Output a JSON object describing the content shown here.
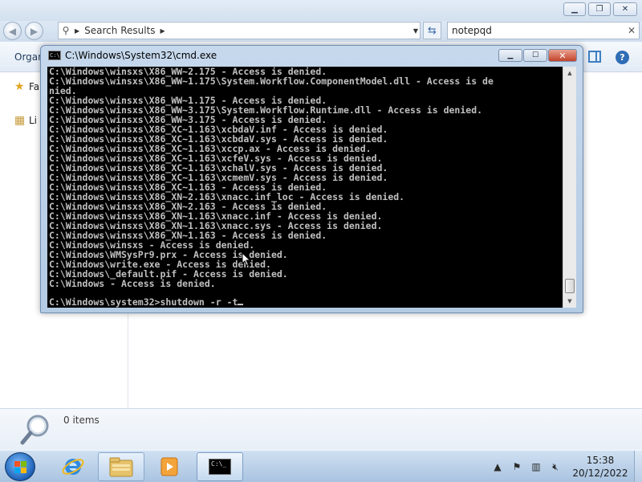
{
  "explorer": {
    "address": {
      "path_label": "Search Results"
    },
    "search": {
      "value": "notepqd"
    },
    "toolbar": {
      "organize_label": "Organ"
    },
    "nav_pane": {
      "favorites_label": "Fa",
      "libraries_label": "Li"
    },
    "details": {
      "items_count": "0 items"
    }
  },
  "cmd": {
    "title": "C:\\Windows\\System32\\cmd.exe",
    "icon_text": "C:\\",
    "lines": [
      "C:\\Windows\\winsxs\\X86_WW~2.175 - Access is denied.",
      "C:\\Windows\\winsxs\\X86_WW~1.175\\System.Workflow.ComponentModel.dll - Access is de",
      "nied.",
      "C:\\Windows\\winsxs\\X86_WW~1.175 - Access is denied.",
      "C:\\Windows\\winsxs\\X86_WW~3.175\\System.Workflow.Runtime.dll - Access is denied.",
      "C:\\Windows\\winsxs\\X86_WW~3.175 - Access is denied.",
      "C:\\Windows\\winsxs\\X86_XC~1.163\\xcbdaV.inf - Access is denied.",
      "C:\\Windows\\winsxs\\X86_XC~1.163\\xcbdaV.sys - Access is denied.",
      "C:\\Windows\\winsxs\\X86_XC~1.163\\xccp.ax - Access is denied.",
      "C:\\Windows\\winsxs\\X86_XC~1.163\\xcfeV.sys - Access is denied.",
      "C:\\Windows\\winsxs\\X86_XC~1.163\\xchalV.sys - Access is denied.",
      "C:\\Windows\\winsxs\\X86_XC~1.163\\xcmemV.sys - Access is denied.",
      "C:\\Windows\\winsxs\\X86_XC~1.163 - Access is denied.",
      "C:\\Windows\\winsxs\\X86_XN~2.163\\xnacc.inf_loc - Access is denied.",
      "C:\\Windows\\winsxs\\X86_XN~2.163 - Access is denied.",
      "C:\\Windows\\winsxs\\X86_XN~1.163\\xnacc.inf - Access is denied.",
      "C:\\Windows\\winsxs\\X86_XN~1.163\\xnacc.sys - Access is denied.",
      "C:\\Windows\\winsxs\\X86_XN~1.163 - Access is denied.",
      "C:\\Windows\\winsxs - Access is denied.",
      "C:\\Windows\\WMSysPr9.prx - Access is denied.",
      "C:\\Windows\\write.exe - Access is denied.",
      "C:\\Windows\\_default.pif - Access is denied.",
      "C:\\Windows - Access is denied."
    ],
    "prompt": "C:\\Windows\\system32>shutdown -r -t"
  },
  "taskbar": {
    "clock_time": "15:38",
    "clock_date": "20/12/2022",
    "cmd_icon_text": "C:\\_"
  },
  "icons": {
    "back": "arrow-left-icon",
    "forward": "arrow-right-icon",
    "search": "magnifier-icon",
    "refresh": "refresh-icon",
    "help": "help-icon"
  }
}
